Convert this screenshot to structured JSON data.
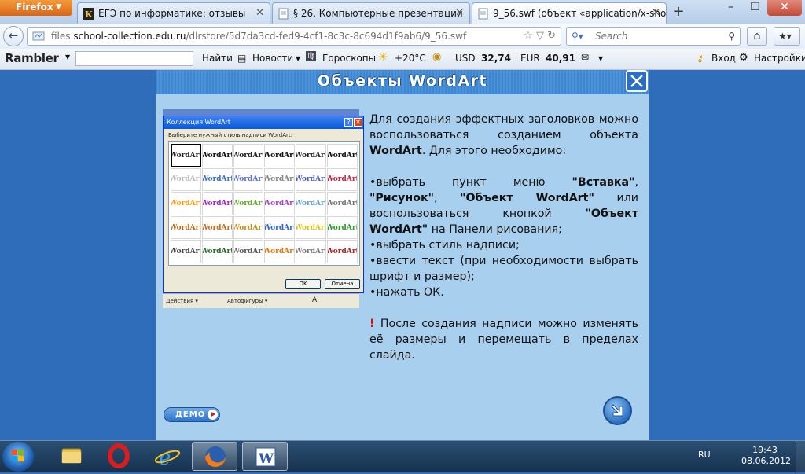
{
  "browser": {
    "menu_button": "Firefox",
    "tabs": [
      {
        "label": "ЕГЭ по информатике: отзывы",
        "active": false
      },
      {
        "label": "§ 26. Компьютерные презентации",
        "active": false
      },
      {
        "label": "9_56.swf (объект «application/x-shoc...",
        "active": true
      }
    ],
    "url_prefix": "files.",
    "url_domain": "school-collection.edu.ru",
    "url_path": "/dlrstore/5d7da3cd-fed9-4cf1-8c3c-8c694d1f9ab6/9_56.swf",
    "search_placeholder": "Search"
  },
  "rambler": {
    "logo": "Rambler",
    "find": "Найти",
    "news": "Новости",
    "horoscopes": "Гороскопы",
    "temperature": "+20°C",
    "usd_label": "USD",
    "usd_value": "32,74",
    "eur_label": "EUR",
    "eur_value": "40,91",
    "login": "Вход",
    "settings": "Настройки"
  },
  "slide": {
    "title": "Объекты WordArt",
    "intro_1": "Для создания эффектных заголовков можно воспользоваться созданием объекта ",
    "intro_bold": "WordArt",
    "intro_2": ". Для этого необходимо:",
    "b1_pre": "•выбрать пункт меню ",
    "b1_menu1": "\"Вставка\"",
    "b1_comma": ", ",
    "b1_menu2": "\"Рисунок\"",
    "b1_comma2": ", ",
    "b1_menu3": "\"Объект WordArt\"",
    "b1_mid": " или воспользоваться кнопкой ",
    "b1_btn": "\"Объект WordArt\"",
    "b1_post": " на Панели рисования;",
    "b2": "•выбрать стиль надписи;",
    "b3": "•ввести текст (при необходимости выбрать шрифт и размер);",
    "b4": "•нажать ОК.",
    "warn_mark": "!",
    "warn_text": " После создания надписи можно изменять её размеры и перемещать в пределах слайда.",
    "demo_label": "ДЕМО",
    "dialog": {
      "title": "Коллекция WordArt",
      "prompt": "Выберите нужный стиль надписи WordArt:",
      "cell_text": "WordArt",
      "ok": "OK",
      "cancel": "Отмена",
      "footer_1": "Действия ▾",
      "footer_2": "Автофигуры ▾"
    }
  },
  "taskbar": {
    "lang": "RU",
    "time": "19:43",
    "date": "08.06.2012"
  },
  "colors": {
    "slide_bg": "#a9cfee",
    "page_bg": "#2f6dba",
    "title_text": "#ffffff",
    "warn": "#d01010"
  }
}
